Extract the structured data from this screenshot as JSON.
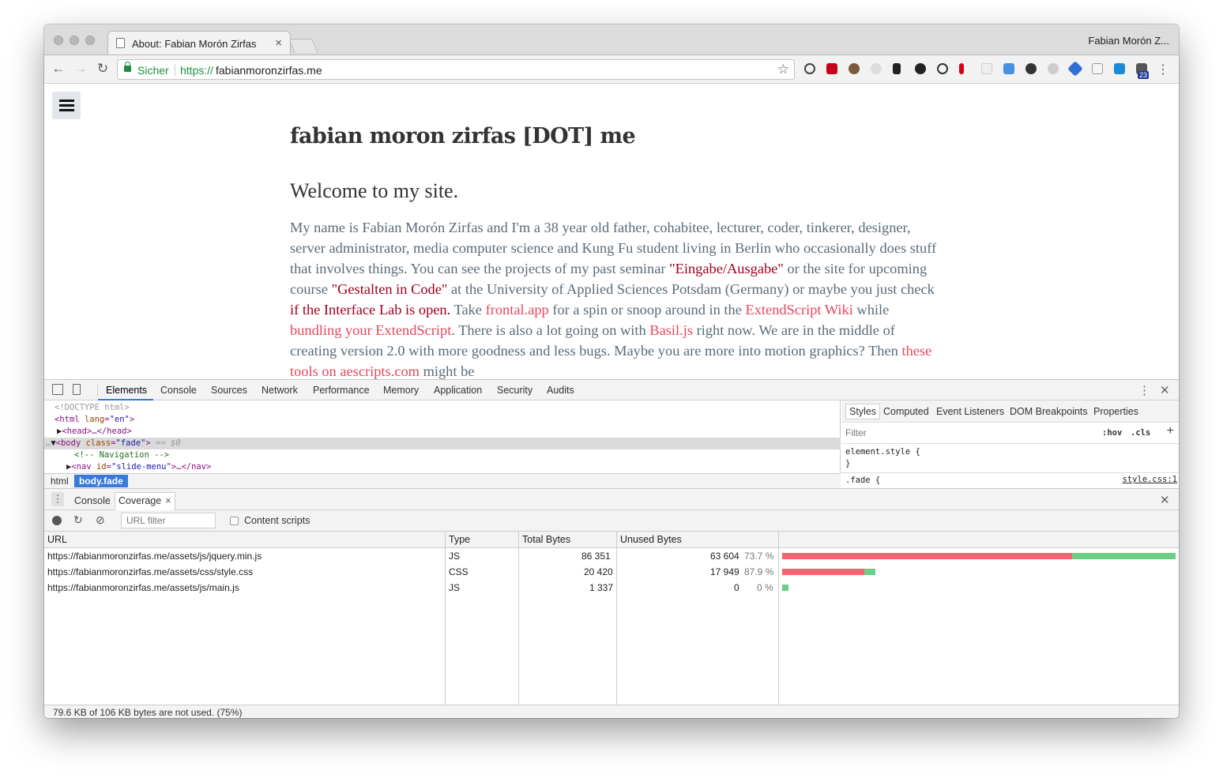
{
  "browser": {
    "tab_title": "About: Fabian Morón Zirfas",
    "tab_close": "×",
    "profile_name": "Fabian Morón Z...",
    "secure_label": "Sicher",
    "url_scheme": "https://",
    "url_host": "fabianmoronzirfas.me",
    "extension_badge": "23"
  },
  "page": {
    "site_title": "fabian moron zirfas [DOT] me",
    "welcome": "Welcome to my site.",
    "intro": {
      "t1": "My name is Fabian Morón Zirfas and I'm a 38 year old father, cohabitee, lecturer, coder, tinkerer, designer, server administrator, media computer science and Kung Fu student living in Berlin who occasionally does stuff that involves things. You can see the projects of my past seminar ",
      "link1": "\"Eingabe/Ausgabe\"",
      "t2": " or the site for upcoming course ",
      "link2": "\"Gestalten in Code\"",
      "t3": " at the University of Applied Sciences Potsdam (Germany) or maybe you just check ",
      "link3": "if the Interface Lab is open.",
      "t4": " Take ",
      "link4": "frontal.app",
      "t5": " for a spin or snoop around in the ",
      "link5": "ExtendScript Wiki",
      "t6": " while ",
      "link6": "bundling your ExtendScript",
      "t7": ". There is also a lot going on with ",
      "link7": "Basil.js",
      "t8": " right now. We are in the middle of creating version 2.0 with more goodness and less bugs. Maybe you are more into motion graphics? Then ",
      "link8": "these tools on aescripts.com",
      "t9": " might be"
    }
  },
  "devtools": {
    "tabs": [
      "Elements",
      "Console",
      "Sources",
      "Network",
      "Performance",
      "Memory",
      "Application",
      "Security",
      "Audits"
    ],
    "active_tab": "Elements",
    "dom": {
      "doctype": "<!DOCTYPE html>",
      "html_open": "<html",
      "html_attr": "lang",
      "html_val": "\"en\"",
      "head": "<head>…</head>",
      "body_tag": "<body",
      "body_attr": "class",
      "body_val": "\"fade\"",
      "body_eq": "== $0",
      "comment": "<!-- Navigation -->",
      "nav_tag": "<nav",
      "nav_attr": "id",
      "nav_val": "\"slide-menu\"",
      "nav_rest": ">…</nav>"
    },
    "breadcrumbs": [
      "html",
      "body.fade"
    ],
    "styles_tabs": [
      "Styles",
      "Computed",
      "Event Listeners",
      "DOM Breakpoints",
      "Properties"
    ],
    "filter_placeholder": "Filter",
    "hov_label": ":hov",
    "cls_label": ".cls",
    "element_style": "element.style {",
    "close_brace": "}",
    "fade_rule": ".fade {",
    "style_source": "style.css:1"
  },
  "drawer": {
    "tabs": [
      "Console",
      "Coverage"
    ],
    "active_tab": "Coverage",
    "url_filter_placeholder": "URL filter",
    "content_scripts_label": "Content scripts",
    "columns": [
      "URL",
      "Type",
      "Total Bytes",
      "Unused Bytes"
    ],
    "rows": [
      {
        "url": "https://fabianmoronzirfas.me/assets/js/jquery.min.js",
        "type": "JS",
        "total": "86 351",
        "unused": "63 604",
        "pct": "73.7 %",
        "total_bytes": 86351,
        "unused_bytes": 63604
      },
      {
        "url": "https://fabianmoronzirfas.me/assets/css/style.css",
        "type": "CSS",
        "total": "20 420",
        "unused": "17 949",
        "pct": "87.9 %",
        "total_bytes": 20420,
        "unused_bytes": 17949
      },
      {
        "url": "https://fabianmoronzirfas.me/assets/js/main.js",
        "type": "JS",
        "total": "1 337",
        "unused": "0",
        "pct": "0 %",
        "total_bytes": 1337,
        "unused_bytes": 0
      }
    ],
    "summary": "79.6 KB of 106 KB bytes are not used. (75%)"
  },
  "colors": {
    "unused_bar": "#f3646e",
    "used_bar": "#6acf84",
    "accent": "#3879d9"
  }
}
